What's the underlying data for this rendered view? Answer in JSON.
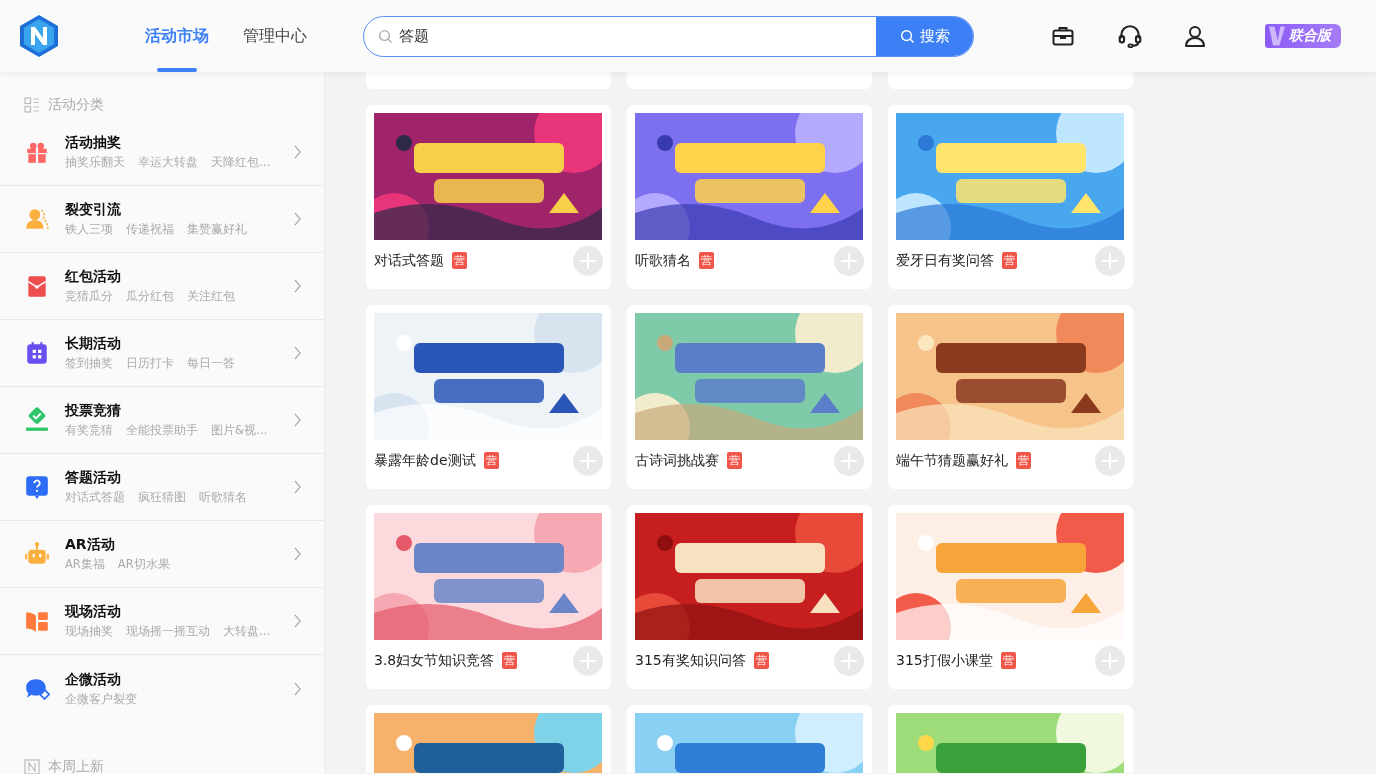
{
  "header": {
    "nav_tabs": [
      {
        "label": "活动市场",
        "selected": true
      },
      {
        "label": "管理中心",
        "selected": false
      }
    ],
    "search": {
      "value": "答题",
      "button": "搜索"
    },
    "edition_badge": "联合版"
  },
  "sidebar": {
    "heading": "活动分类",
    "categories": [
      {
        "title": "活动抽奖",
        "items": [
          "抽奖乐翻天",
          "幸运大转盘",
          "天降红包…"
        ]
      },
      {
        "title": "裂变引流",
        "items": [
          "铁人三项",
          "传递祝福",
          "集赞赢好礼"
        ]
      },
      {
        "title": "红包活动",
        "items": [
          "竞猜瓜分",
          "瓜分红包",
          "关注红包"
        ]
      },
      {
        "title": "长期活动",
        "items": [
          "签到抽奖",
          "日历打卡",
          "每日一答"
        ]
      },
      {
        "title": "投票竞猜",
        "items": [
          "有奖竞猜",
          "全能投票助手",
          "图片&视…"
        ]
      },
      {
        "title": "答题活动",
        "items": [
          "对话式答题",
          "疯狂猜图",
          "听歌猜名"
        ]
      },
      {
        "title": "AR活动",
        "items": [
          "AR集福",
          "AR切水果"
        ]
      },
      {
        "title": "现场活动",
        "items": [
          "现场抽奖",
          "现场摇一摇互动",
          "大转盘…"
        ]
      },
      {
        "title": "企微活动",
        "items": [
          "企微客户裂变"
        ]
      }
    ],
    "footer_heading": "本周上新"
  },
  "cards": [
    {
      "kind": "cut_top"
    },
    {
      "kind": "cut_top"
    },
    {
      "kind": "cut_top"
    },
    {
      "kind": "full",
      "title": "对话式答题",
      "tag": "营"
    },
    {
      "kind": "full",
      "title": "听歌猜名",
      "tag": "营"
    },
    {
      "kind": "full",
      "title": "爱牙日有奖问答",
      "tag": "营"
    },
    {
      "kind": "full",
      "title": "暴露年龄de测试",
      "tag": "营"
    },
    {
      "kind": "full",
      "title": "古诗词挑战赛",
      "tag": "营"
    },
    {
      "kind": "full",
      "title": "端午节猜题赢好礼",
      "tag": "营"
    },
    {
      "kind": "full",
      "title": "3.8妇女节知识竞答",
      "tag": "营"
    },
    {
      "kind": "full",
      "title": "315有奖知识问答",
      "tag": "营"
    },
    {
      "kind": "full",
      "title": "315打假小课堂",
      "tag": "营"
    },
    {
      "kind": "cut_bottom"
    },
    {
      "kind": "cut_bottom"
    },
    {
      "kind": "cut_bottom"
    }
  ]
}
